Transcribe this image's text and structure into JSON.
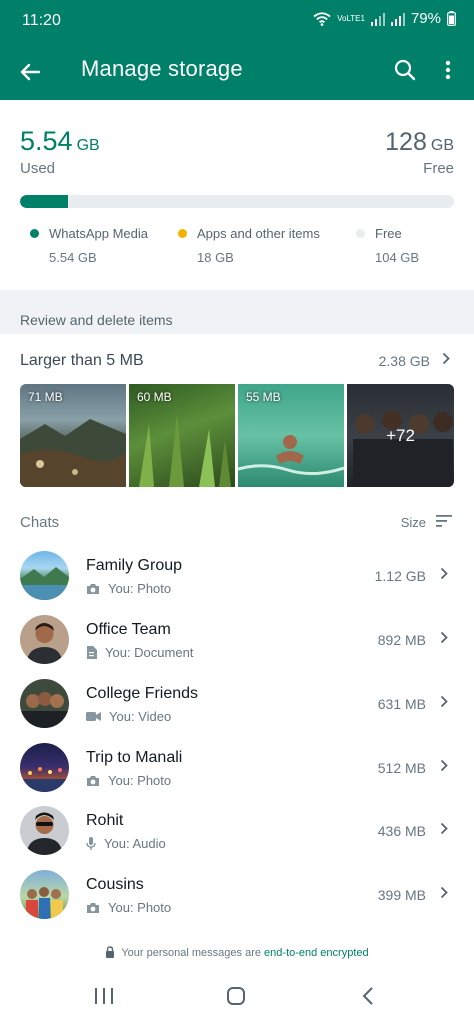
{
  "status_bar": {
    "time": "11:20",
    "network": "VoLTE1",
    "battery": "79%"
  },
  "app_bar": {
    "title": "Manage storage"
  },
  "usage": {
    "used_value": "5.54",
    "used_unit": "GB",
    "used_label": "Used",
    "free_value": "128",
    "free_unit": "GB",
    "free_label": "Free",
    "bar": {
      "media_fraction": 0.11,
      "apps_fraction": 0.0
    },
    "legend": [
      {
        "label": "WhatsApp Media",
        "size": "5.54 GB",
        "color": "#008069"
      },
      {
        "label": "Apps and other items",
        "size": "18 GB",
        "color": "#f0b400"
      },
      {
        "label": "Free",
        "size": "104 GB",
        "color": "#e9edef"
      }
    ]
  },
  "review": {
    "title": "Review and delete items"
  },
  "larger": {
    "label": "Larger than 5 MB",
    "total": "2.38 GB",
    "thumbs": [
      {
        "size": "71 MB"
      },
      {
        "size": "60 MB"
      },
      {
        "size": "55 MB"
      },
      {
        "more": "+72"
      }
    ]
  },
  "chats": {
    "title": "Chats",
    "sort_label": "Size",
    "items": [
      {
        "name": "Family Group",
        "sub": "You: Photo",
        "kind": "camera-icon",
        "size": "1.12 GB"
      },
      {
        "name": "Office Team",
        "sub": "You: Document",
        "kind": "document-icon",
        "size": "892 MB"
      },
      {
        "name": "College Friends",
        "sub": "You: Video",
        "kind": "video-icon",
        "size": "631 MB"
      },
      {
        "name": "Trip to Manali",
        "sub": "You: Photo",
        "kind": "camera-icon",
        "size": "512 MB"
      },
      {
        "name": "Rohit",
        "sub": "You: Audio",
        "kind": "mic-icon",
        "size": "436 MB"
      },
      {
        "name": "Cousins",
        "sub": "You: Photo",
        "kind": "camera-icon",
        "size": "399 MB"
      }
    ]
  },
  "footer": {
    "prefix": "Your personal messages are ",
    "link": "end-to-end encrypted"
  },
  "colors": {
    "accent": "#008069",
    "apps": "#f0b400",
    "track": "#e9edef"
  }
}
